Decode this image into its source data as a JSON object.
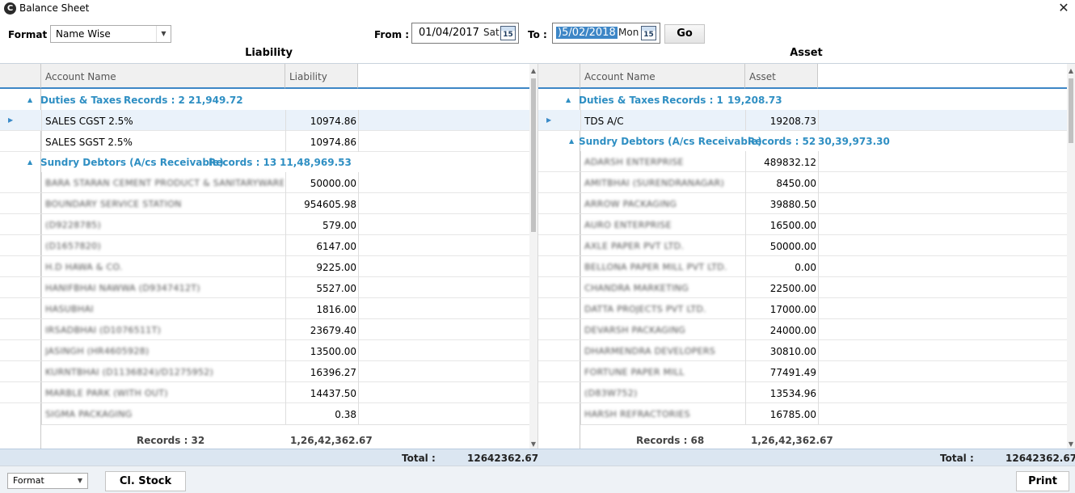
{
  "window": {
    "title": "Balance Sheet",
    "app_icon": "C"
  },
  "toolbar": {
    "format_label": "Format :",
    "format_value": "Name Wise",
    "from_label": "From :",
    "from_date": "01/04/2017",
    "from_day": "Sat",
    "to_label": "To :",
    "to_date": ")5/02/2018",
    "to_day": "Mon",
    "calendar_day": "15",
    "go_label": "Go"
  },
  "liability": {
    "section_title": "Liability",
    "columns": [
      "Account Name",
      "Liability"
    ],
    "groups": [
      {
        "name": "Duties & Taxes",
        "records": "Records :  2",
        "total": "21,949.72"
      },
      {
        "name": "Sundry Debtors (A/cs Receivable)",
        "records": "Records :  13",
        "total": "11,48,969.53"
      }
    ],
    "rows": [
      {
        "name": "SALES CGST 2.5%",
        "amount": "10974.86"
      },
      {
        "name": "SALES SGST 2.5%",
        "amount": "10974.86"
      },
      {
        "name": "BARA STARAN CEMENT PRODUCT & SANITARYWARE",
        "amount": "50000.00"
      },
      {
        "name": "BOUNDARY SERVICE STATION",
        "amount": "954605.98"
      },
      {
        "name": "(D9228785)",
        "amount": "579.00"
      },
      {
        "name": "(D1657820)",
        "amount": "6147.00"
      },
      {
        "name": "H.D HAWA & CO.",
        "amount": "9225.00"
      },
      {
        "name": "HANIFBHAI NAWWA (D9347412T)",
        "amount": "5527.00"
      },
      {
        "name": "HASUBHAI",
        "amount": "1816.00"
      },
      {
        "name": "IRSADBHAI (D1076511T)",
        "amount": "23679.40"
      },
      {
        "name": "JASINGH (HR4605928)",
        "amount": "13500.00"
      },
      {
        "name": "KURNTBHAI (D1136824)/D1275952)",
        "amount": "16396.27"
      },
      {
        "name": "MARBLE PARK (WITH OUT)",
        "amount": "14437.50"
      },
      {
        "name": "SIGMA PACKAGING",
        "amount": "0.38"
      }
    ],
    "footer_records": "Records : 32",
    "footer_total": "1,26,42,362.67"
  },
  "asset": {
    "section_title": "Asset",
    "columns": [
      "Account Name",
      "Asset"
    ],
    "groups": [
      {
        "name": "Duties & Taxes",
        "records": "Records :  1",
        "total": "19,208.73"
      },
      {
        "name": "Sundry Debtors (A/cs Receivable)",
        "records": "Records :  52",
        "total": "30,39,973.30"
      }
    ],
    "rows": [
      {
        "name": "TDS A/C",
        "amount": "19208.73"
      },
      {
        "name": "ADARSH ENTERPRISE",
        "amount": "489832.12"
      },
      {
        "name": "AMITBHAI (SURENDRANAGAR)",
        "amount": "8450.00"
      },
      {
        "name": "ARROW PACKAGING",
        "amount": "39880.50"
      },
      {
        "name": "AURO ENTERPRISE",
        "amount": "16500.00"
      },
      {
        "name": "AXLE PAPER PVT LTD.",
        "amount": "50000.00"
      },
      {
        "name": "BELLONA PAPER MILL PVT LTD.",
        "amount": "0.00"
      },
      {
        "name": "CHANDRA MARKETING",
        "amount": "22500.00"
      },
      {
        "name": "DATTA PROJECTS PVT LTD.",
        "amount": "17000.00"
      },
      {
        "name": "DEVARSH PACKAGING",
        "amount": "24000.00"
      },
      {
        "name": "DHARMENDRA DEVELOPERS",
        "amount": "30810.00"
      },
      {
        "name": "FORTUNE PAPER MILL",
        "amount": "77491.49"
      },
      {
        "name": "(D83W752)",
        "amount": "13534.96"
      },
      {
        "name": "HARSH REFRACTORIES",
        "amount": "16785.00"
      }
    ],
    "footer_records": "Records : 68",
    "footer_total": "1,26,42,362.67"
  },
  "totals": {
    "label": "Total :",
    "left_value": "12642362.67",
    "right_value": "12642362.67"
  },
  "bottom": {
    "format_value": "Format",
    "cl_stock_label": "Cl. Stock",
    "print_label": "Print"
  },
  "colors": {
    "accent": "#2f8fc3",
    "header_underline": "#3d86c6",
    "total_bar": "#dbe6f1"
  }
}
